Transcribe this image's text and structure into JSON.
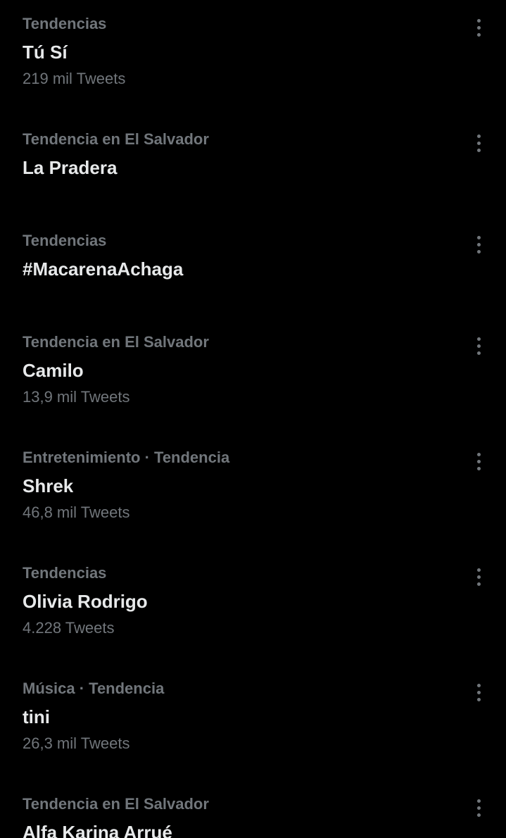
{
  "trends": [
    {
      "context": "Tendencias",
      "topic": "Tú Sí",
      "count": "219 mil Tweets"
    },
    {
      "context": "Tendencia en El Salvador",
      "topic": "La Pradera",
      "count": ""
    },
    {
      "context": "Tendencias",
      "topic": "#MacarenaAchaga",
      "count": ""
    },
    {
      "context": "Tendencia en El Salvador",
      "topic": "Camilo",
      "count": "13,9 mil Tweets"
    },
    {
      "context": "Entretenimiento · Tendencia",
      "topic": "Shrek",
      "count": "46,8 mil Tweets"
    },
    {
      "context": "Tendencias",
      "topic": "Olivia Rodrigo",
      "count": "4.228 Tweets"
    },
    {
      "context": "Música · Tendencia",
      "topic": "tini",
      "count": "26,3 mil Tweets"
    },
    {
      "context": "Tendencia en El Salvador",
      "topic": "Alfa Karina Arrué",
      "count": ""
    }
  ],
  "icons": {
    "more": "more-options-icon"
  },
  "colors": {
    "background": "#000000",
    "primary_text": "#e7e9ea",
    "secondary_text": "#71767b"
  }
}
